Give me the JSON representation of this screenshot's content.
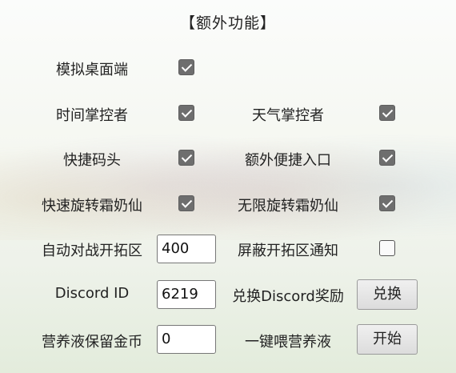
{
  "title": "【额外功能】",
  "options": {
    "virtual_desktop": {
      "label": "模拟桌面端",
      "checked": true
    },
    "time_controller": {
      "label": "时间掌控者",
      "checked": true
    },
    "weather_controller": {
      "label": "天气掌控者",
      "checked": true
    },
    "quick_dock": {
      "label": "快捷码头",
      "checked": true
    },
    "extra_shortcut": {
      "label": "额外便捷入口",
      "checked": true
    },
    "fast_spin_frost": {
      "label": "快速旋转霜奶仙",
      "checked": true
    },
    "infinite_spin_frost": {
      "label": "无限旋转霜奶仙",
      "checked": true
    },
    "block_expansion_notice": {
      "label": "屏蔽开拓区通知",
      "checked": false
    }
  },
  "auto_battle": {
    "label": "自动对战开拓区",
    "value": "400"
  },
  "discord_id": {
    "label": "Discord ID",
    "value": "6219"
  },
  "redeem_discord": {
    "label": "兑换Discord奖励",
    "button": "兑换"
  },
  "nutrient_gold": {
    "label": "营养液保留金币",
    "value": "0"
  },
  "feed_nutrient": {
    "label": "一键喂营养液",
    "button": "开始"
  },
  "colors": {
    "checkbox_checked": "#6e6e6e",
    "button_bg": "#e4e4e4"
  }
}
